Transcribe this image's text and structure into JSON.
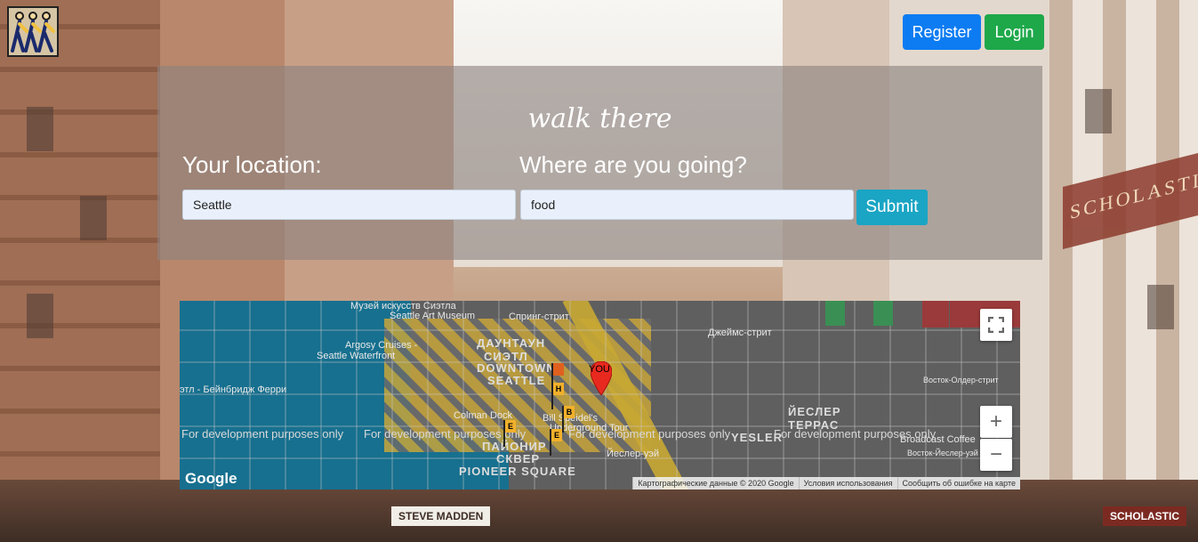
{
  "header": {
    "logo_icon": "walking-people-icon",
    "register_label": "Register",
    "login_label": "Login"
  },
  "search": {
    "brand": "walk there",
    "location_label": "Your location:",
    "destination_label": "Where are you going?",
    "location_value": "Seattle",
    "destination_value": "food",
    "submit_label": "Submit"
  },
  "map": {
    "labels": {
      "museum": "Музей искусств Сиэтла",
      "museum_en": "Seattle Art Museum",
      "argosy": "Argosy Cruises -",
      "argosy_en": "Seattle Waterfront",
      "downtown_ru": "ДАУНТАУН",
      "downtown_ru2": "СИЭТЛ",
      "downtown_en": "DOWNTOWN",
      "seattle": "SEATTLE",
      "ferry": "этл - Бейнбридж Ферри",
      "colman": "Colman Dock",
      "bill": "Bill Speidel's",
      "underground": "Underground Tour",
      "pioneer_ru": "ПАЙОНИР",
      "pioneer_ru2": "СКВЕР",
      "pioneer_en": "PIONEER SQUARE",
      "yesler_st": "Йеслер-уэй",
      "yesler_ru": "ЙЕСЛЕР",
      "terrace_ru": "ТЕРРАС",
      "yesler_en": "YESLER",
      "boston": "Восток-Олдер-стрит",
      "broadcast": "Broadcast Coffee",
      "broadcast_ru": "Восток-Йеслер-уэй",
      "james": "Джеймс-стрит",
      "spring": "Спринг-стрит",
      "you": "YOU"
    },
    "dev_watermark": "For development purposes only",
    "google_logo": "Google",
    "attribution": {
      "data": "Картографические данные © 2020 Google",
      "terms": "Условия использования",
      "report": "Сообщить об ошибке на карте"
    },
    "flags": [
      "H",
      "B",
      "E",
      "E",
      "E"
    ],
    "controls": {
      "fullscreen_icon": "fullscreen-icon",
      "zoom_in": "+",
      "zoom_out": "−"
    }
  }
}
